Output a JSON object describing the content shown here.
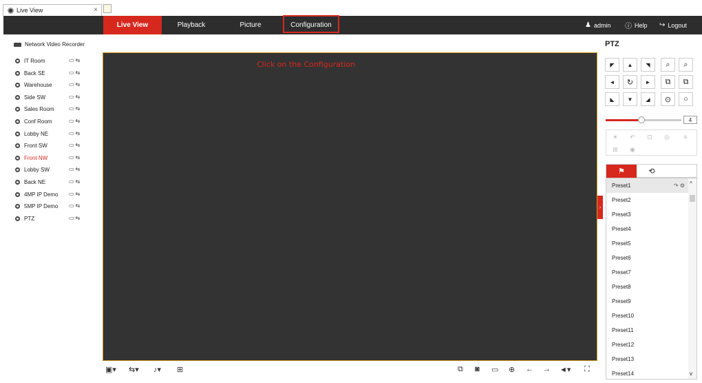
{
  "browser": {
    "tab_title": "Live View",
    "close": "×"
  },
  "nav": {
    "tabs": [
      {
        "label": "Live View",
        "active": true
      },
      {
        "label": "Playback"
      },
      {
        "label": "Picture"
      },
      {
        "label": "Configuration",
        "highlighted": true
      }
    ],
    "user": "admin",
    "help": "Help",
    "logout": "Logout"
  },
  "left": {
    "device": "Network Video Recorder",
    "cameras": [
      {
        "name": "IT Room"
      },
      {
        "name": "Back SE"
      },
      {
        "name": "Warehouse"
      },
      {
        "name": "Side SW"
      },
      {
        "name": "Sales Room"
      },
      {
        "name": "Conf Room"
      },
      {
        "name": "Lobby NE"
      },
      {
        "name": "Front SW"
      },
      {
        "name": "Front NW",
        "selected": true
      },
      {
        "name": "Lobby SW"
      },
      {
        "name": "Back NE"
      },
      {
        "name": "4MP IP Demo"
      },
      {
        "name": "5MP IP Demo"
      },
      {
        "name": "PTZ"
      }
    ]
  },
  "video": {
    "annotation": "Click on the Configuration"
  },
  "ptz": {
    "title": "PTZ",
    "speed": "4",
    "speed_fraction": 0.47,
    "presets": [
      "Preset1",
      "Preset2",
      "Preset3",
      "Preset4",
      "Preset5",
      "Preset6",
      "Preset7",
      "Preset8",
      "Preset9",
      "Preset10",
      "Preset11",
      "Preset12",
      "Preset13",
      "Preset14"
    ]
  },
  "colors": {
    "accent": "#d7281e",
    "navbar": "#2d2d2d",
    "video_bg": "#333333",
    "video_border": "#d6a021"
  }
}
